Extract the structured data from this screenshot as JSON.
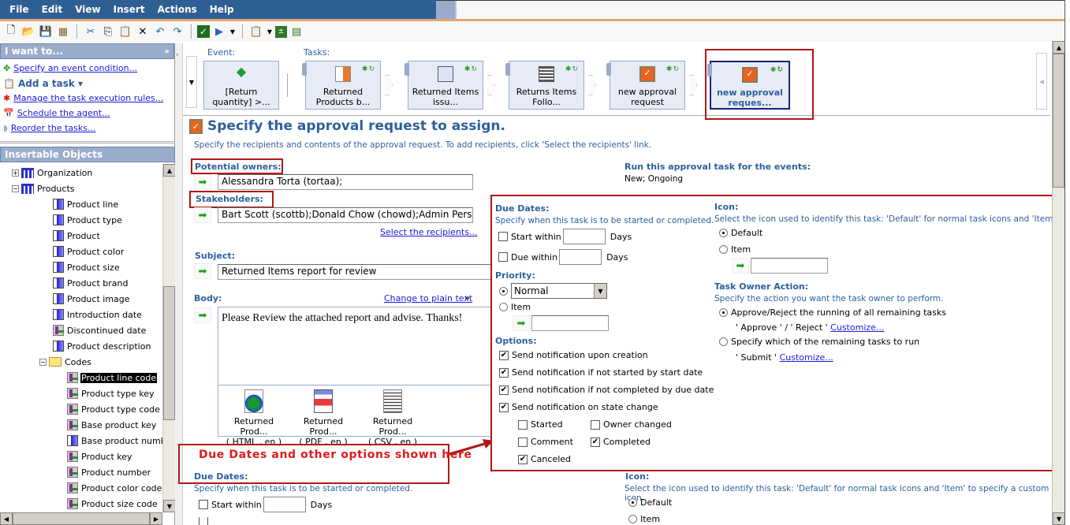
{
  "menubar": {
    "items": [
      "File",
      "Edit",
      "View",
      "Insert",
      "Actions",
      "Help"
    ]
  },
  "toolbar": {
    "icons": [
      "new-icon",
      "open-icon",
      "save-icon",
      "save-all-icon",
      "cut-icon",
      "copy-icon",
      "paste-icon",
      "delete-icon",
      "undo-icon",
      "redo-icon",
      "validate-icon",
      "run-icon",
      "run-dropdown-icon",
      "add-task-icon",
      "variables-icon",
      "properties-icon"
    ]
  },
  "i_want_to": {
    "title": "I want to...",
    "items": [
      {
        "label": "Specify an event condition...",
        "icon": "event-condition-icon"
      },
      {
        "label": "Add a task ▾",
        "icon": "add-task-icon"
      },
      {
        "label": "Manage the task execution rules...",
        "icon": "execution-rules-icon"
      },
      {
        "label": "Schedule the agent...",
        "icon": "schedule-icon"
      },
      {
        "label": "Reorder the tasks...",
        "icon": "reorder-icon"
      }
    ]
  },
  "insertable_objects": {
    "title": "Insertable Objects",
    "tree": [
      {
        "label": "Organization",
        "type": "hierarchy",
        "level": 0,
        "expander": "+"
      },
      {
        "label": "Products",
        "type": "hierarchy",
        "level": 0,
        "expander": "-"
      },
      {
        "label": "Product line",
        "type": "dimension",
        "level": 1
      },
      {
        "label": "Product type",
        "type": "dimension",
        "level": 1
      },
      {
        "label": "Product",
        "type": "dimension",
        "level": 1
      },
      {
        "label": "Product color",
        "type": "dimension",
        "level": 1
      },
      {
        "label": "Product size",
        "type": "dimension",
        "level": 1
      },
      {
        "label": "Product brand",
        "type": "dimension",
        "level": 1
      },
      {
        "label": "Product image",
        "type": "dimension",
        "level": 1
      },
      {
        "label": "Introduction date",
        "type": "dimension",
        "level": 1
      },
      {
        "label": "Discontinued date",
        "type": "code",
        "level": 1
      },
      {
        "label": "Product description",
        "type": "dimension",
        "level": 1
      },
      {
        "label": "Codes",
        "type": "folder",
        "level": 1,
        "expander": "-"
      },
      {
        "label": "Product line code",
        "type": "code",
        "level": 2,
        "selected": true
      },
      {
        "label": "Product type key",
        "type": "code",
        "level": 2
      },
      {
        "label": "Product type code",
        "type": "code",
        "level": 2
      },
      {
        "label": "Base product key",
        "type": "code",
        "level": 2
      },
      {
        "label": "Base product number",
        "type": "dimension",
        "level": 2
      },
      {
        "label": "Product key",
        "type": "code",
        "level": 2
      },
      {
        "label": "Product number",
        "type": "code",
        "level": 2
      },
      {
        "label": "Product color code",
        "type": "code",
        "level": 2
      },
      {
        "label": "Product size code",
        "type": "code",
        "level": 2
      }
    ]
  },
  "flow": {
    "event_label": "Event:",
    "tasks_label": "Tasks:",
    "event": {
      "label": "[Return quantity] >...",
      "icon": "event-diamond-icon"
    },
    "tasks": [
      {
        "label": "Returned Products b...",
        "icon": "report-icon"
      },
      {
        "label": "Returned Items issu...",
        "icon": "email-icon"
      },
      {
        "label": "Returns Items Follo...",
        "icon": "news-icon"
      },
      {
        "label": "new approval request",
        "icon": "approval-icon"
      },
      {
        "label": "new approval reques...",
        "icon": "approval-icon",
        "selected": true
      }
    ]
  },
  "main": {
    "title": "Specify the approval request to assign.",
    "description": "Specify the recipients and contents of the approval request. To add recipients, click 'Select the recipients' link.",
    "potential_owners_label": "Potential owners:",
    "potential_owners_value": "Alessandra Torta (tortaa);",
    "stakeholders_label": "Stakeholders:",
    "stakeholders_value": "Bart Scott (scottb);Donald Chow (chowd);Admin Person",
    "select_recipients_link": "Select the recipients...",
    "run_for_events_label": "Run this approval task for the events:",
    "run_for_events_value": "New; Ongoing",
    "subject_label": "Subject:",
    "subject_value": "Returned Items report for review",
    "body_label": "Body:",
    "change_plain_text_link": "Change to plain text",
    "body_value": "Please Review the attached report and advise. Thanks!",
    "attachments": [
      {
        "name": "Returned Prod...",
        "format": "( HTML , en )",
        "icon": "html-globe-icon"
      },
      {
        "name": "Returned Prod...",
        "format": "( PDF , en )",
        "icon": "pdf-report-icon"
      },
      {
        "name": "Returned Prod...",
        "format": "( CSV , en )",
        "icon": "csv-report-icon"
      }
    ],
    "callout_text": "Due Dates and other options shown here",
    "bottom_due_dates_label": "Due Dates:",
    "bottom_due_dates_desc": "Specify when this task is to be started or completed.",
    "bottom_start_within": "Start within",
    "bottom_days": "Days",
    "bottom_icon_label": "Icon:",
    "bottom_icon_desc": "Select the icon used to identify this task: 'Default' for normal task icons and 'Item' to specify a custom icon.",
    "bottom_default": "Default",
    "bottom_item": "Item"
  },
  "options_panel": {
    "due_dates_label": "Due Dates:",
    "due_dates_desc": "Specify when this task is to be started or completed.",
    "start_within": {
      "label": "Start within",
      "checked": false,
      "value": "",
      "unit": "Days"
    },
    "due_within": {
      "label": "Due within",
      "checked": false,
      "value": "",
      "unit": "Days"
    },
    "priority_label": "Priority:",
    "priority_value": "Normal",
    "priority_item_label": "Item",
    "options_label": "Options:",
    "options": [
      {
        "label": "Send notification upon creation",
        "checked": true
      },
      {
        "label": "Send notification if not started by start date",
        "checked": true
      },
      {
        "label": "Send notification if not completed by due date",
        "checked": true
      },
      {
        "label": "Send notification on state change",
        "checked": true
      }
    ],
    "state_changes": [
      {
        "label": "Started",
        "checked": false
      },
      {
        "label": "Owner changed",
        "checked": false
      },
      {
        "label": "Comment",
        "checked": false
      },
      {
        "label": "Completed",
        "checked": true
      },
      {
        "label": "Canceled",
        "checked": true
      }
    ],
    "icon_label": "Icon:",
    "icon_desc": "Select the icon used to identify this task: 'Default' for normal task icons and 'Item' to specify a",
    "icon_default": "Default",
    "icon_item": "Item",
    "task_owner_label": "Task Owner Action:",
    "task_owner_desc": "Specify the action you want the task owner to perform.",
    "approve_reject": "Approve/Reject the running of all remaining tasks",
    "approve_reject_sub": "' Approve ' / ' Reject '",
    "specify_remaining": "Specify which of the remaining tasks to run",
    "submit_sub": "' Submit '",
    "customize_link": "Customize..."
  }
}
